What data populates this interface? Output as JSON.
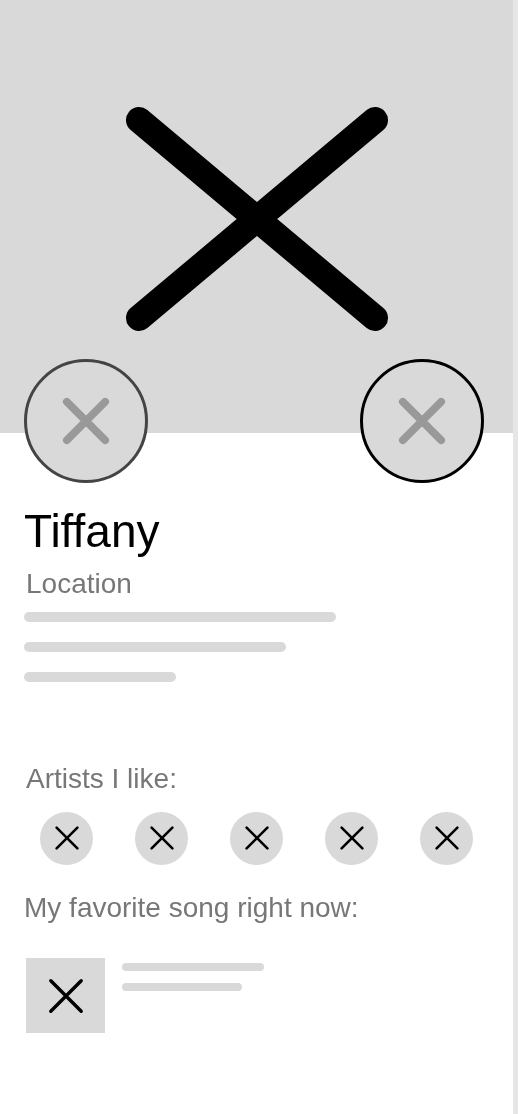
{
  "action_buttons": [
    {
      "selected": false
    },
    {
      "selected": true
    }
  ],
  "profile": {
    "name": "Tiffany",
    "location": "Location"
  },
  "artists_section": {
    "title": "Artists I like:",
    "artists": [
      {
        "kind": "placeholder"
      },
      {
        "kind": "placeholder"
      },
      {
        "kind": "placeholder"
      },
      {
        "kind": "placeholder"
      },
      {
        "kind": "placeholder"
      }
    ]
  },
  "song_section": {
    "title": "My favorite song right now:",
    "song": {
      "kind": "placeholder"
    }
  }
}
